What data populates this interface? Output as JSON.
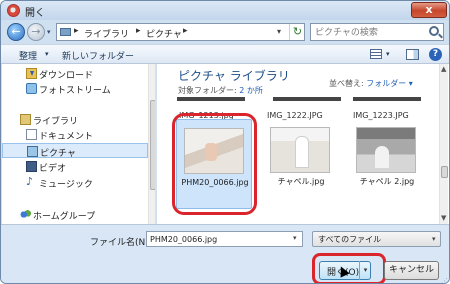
{
  "window": {
    "title": "開く",
    "close": "x"
  },
  "navigation": {
    "back": "←",
    "forward": "→",
    "recent": "▾",
    "breadcrumb": [
      "ライブラリ",
      "ピクチャ"
    ],
    "sep": "▸",
    "refresh": "↻",
    "search_placeholder": "ピクチャの検索"
  },
  "toolbar": {
    "organize": "整理",
    "new_folder": "新しいフォルダー",
    "help": "?"
  },
  "nav_pane": {
    "items": [
      {
        "label": "ダウンロード",
        "icon": "download-folder-icon"
      },
      {
        "label": "フォトストリーム",
        "icon": "photostream-icon"
      },
      {
        "label": "ライブラリ",
        "icon": "library-icon"
      },
      {
        "label": "ドキュメント",
        "icon": "documents-icon"
      },
      {
        "label": "ピクチャ",
        "icon": "pictures-icon",
        "selected": true
      },
      {
        "label": "ビデオ",
        "icon": "video-icon"
      },
      {
        "label": "ミュージック",
        "icon": "music-icon",
        "glyph": "♪"
      },
      {
        "label": "ホームグループ",
        "icon": "homegroup-icon"
      }
    ]
  },
  "content": {
    "library_title": "ピクチャ ライブラリ",
    "folder_label": "対象フォルダー:",
    "folder_link": "2 か所",
    "arrange_label": "並べ替え:",
    "arrange_value": "フォルダー ▾",
    "top_row": [
      "IMG_1213.jpg",
      "IMG_1222.JPG",
      "IMG_1223.JPG"
    ],
    "thumbnails": [
      {
        "name": "PHM20_0066.jpg",
        "selected": true
      },
      {
        "name": "チャペル.jpg",
        "selected": false
      },
      {
        "name": "チャペル 2.jpg",
        "selected": false
      }
    ]
  },
  "bottom": {
    "file_name_label": "ファイル名(N):",
    "file_name_value": "PHM20_0066.jpg",
    "file_type": "すべてのファイル",
    "open_label": "開く(O)",
    "cancel_label": "キャンセル"
  }
}
